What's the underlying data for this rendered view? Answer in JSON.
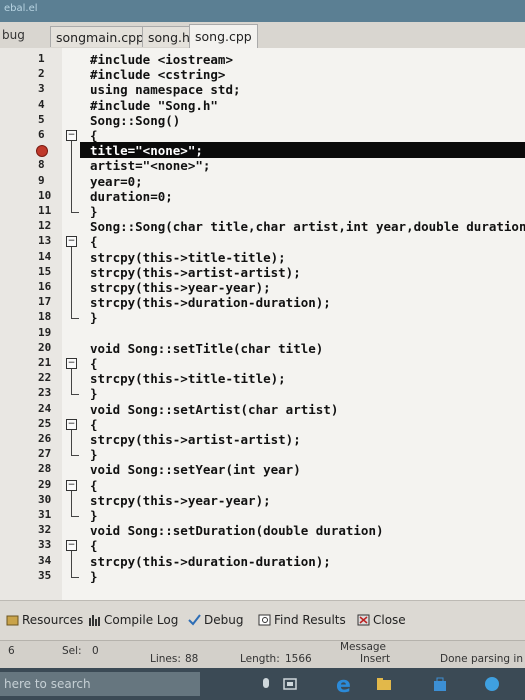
{
  "window": {
    "title_fragment": "ebal.el"
  },
  "menu": {
    "debug_label": "bug"
  },
  "tabs": [
    {
      "label": "songmain.cpp",
      "active": false
    },
    {
      "label": "song.h",
      "active": false
    },
    {
      "label": "song.cpp",
      "active": true
    }
  ],
  "editor": {
    "lines": [
      {
        "n": "1",
        "text": "#include <iostream>"
      },
      {
        "n": "2",
        "text": "#include <cstring>"
      },
      {
        "n": "3",
        "text": "using namespace std;"
      },
      {
        "n": "4",
        "text": "#include \"Song.h\""
      },
      {
        "n": "5",
        "text": "Song::Song()"
      },
      {
        "n": "6",
        "text": "{"
      },
      {
        "n": "7",
        "text": "title=\"<none>\";"
      },
      {
        "n": "8",
        "text": "artist=\"<none>\";"
      },
      {
        "n": "9",
        "text": "year=0;"
      },
      {
        "n": "10",
        "text": "duration=0;"
      },
      {
        "n": "11",
        "text": "}"
      },
      {
        "n": "12",
        "text": "Song::Song(char title,char artist,int year,double duration)"
      },
      {
        "n": "13",
        "text": "{"
      },
      {
        "n": "14",
        "text": "strcpy(this->title-title);"
      },
      {
        "n": "15",
        "text": "strcpy(this->artist-artist);"
      },
      {
        "n": "16",
        "text": "strcpy(this->year-year);"
      },
      {
        "n": "17",
        "text": "strcpy(this->duration-duration);"
      },
      {
        "n": "18",
        "text": "}"
      },
      {
        "n": "19",
        "text": ""
      },
      {
        "n": "20",
        "text": "void Song::setTitle(char title)"
      },
      {
        "n": "21",
        "text": "{"
      },
      {
        "n": "22",
        "text": "strcpy(this->title-title);"
      },
      {
        "n": "23",
        "text": "}"
      },
      {
        "n": "24",
        "text": "void Song::setArtist(char artist)"
      },
      {
        "n": "25",
        "text": "{"
      },
      {
        "n": "26",
        "text": "strcpy(this->artist-artist);"
      },
      {
        "n": "27",
        "text": "}"
      },
      {
        "n": "28",
        "text": "void Song::setYear(int year)"
      },
      {
        "n": "29",
        "text": "{"
      },
      {
        "n": "30",
        "text": "strcpy(this->year-year);"
      },
      {
        "n": "31",
        "text": "}"
      },
      {
        "n": "32",
        "text": "void Song::setDuration(double duration)"
      },
      {
        "n": "33",
        "text": "{"
      },
      {
        "n": "34",
        "text": "strcpy(this->duration-duration);"
      },
      {
        "n": "35",
        "text": "}"
      }
    ],
    "breakpoint_line": "7"
  },
  "bottom_tabs": [
    {
      "label": "Resources",
      "icon": "resources-icon"
    },
    {
      "label": "Compile Log",
      "icon": "compile-log-icon"
    },
    {
      "label": "Debug",
      "icon": "debug-check-icon"
    },
    {
      "label": "Find Results",
      "icon": "find-results-icon"
    },
    {
      "label": "Close",
      "icon": "close-icon"
    }
  ],
  "status": {
    "message_header": "Message",
    "line": "6",
    "sel_label": "Sel:",
    "sel_value": "0",
    "lines_label": "Lines:",
    "lines_value": "88",
    "length_label": "Length:",
    "length_value": "1566",
    "mode": "Insert",
    "parse_status": "Done parsing in"
  },
  "taskbar": {
    "search_placeholder": "here to search"
  },
  "colors": {
    "highlight_line": "#0a0a0a",
    "breakpoint": "#c0392b",
    "taskbar": "#3b4a55"
  }
}
